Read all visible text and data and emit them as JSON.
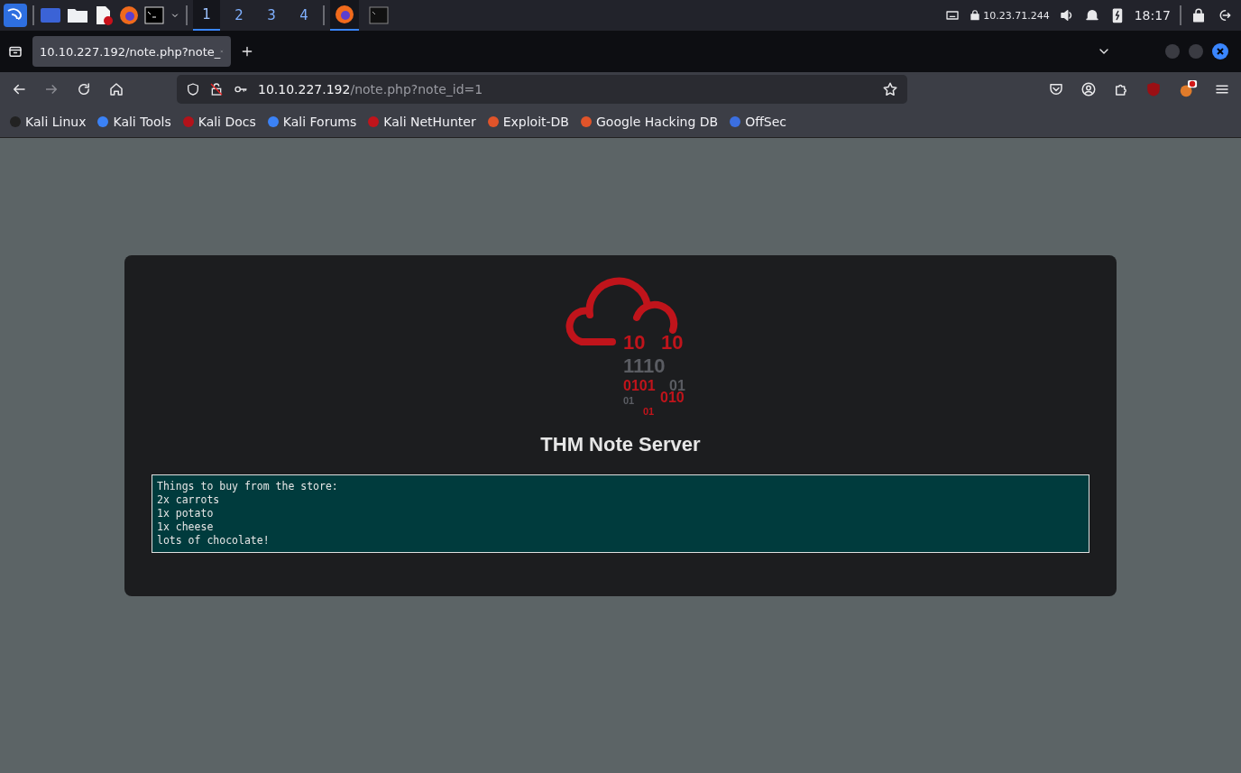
{
  "taskbar": {
    "workspaces": [
      {
        "label": "1",
        "selected": true
      },
      {
        "label": "2",
        "selected": false
      },
      {
        "label": "3",
        "selected": false
      },
      {
        "label": "4",
        "selected": false
      }
    ],
    "ip": "10.23.71.244",
    "clock": "18:17"
  },
  "browser": {
    "tab": {
      "title": "10.10.227.192/note.php?note_"
    },
    "url": {
      "host": "10.10.227.192",
      "path": "/note.php?note_id=1"
    },
    "bookmarks": [
      "Kali Linux",
      "Kali Tools",
      "Kali Docs",
      "Kali Forums",
      "Kali NetHunter",
      "Exploit-DB",
      "Google Hacking DB",
      "OffSec"
    ]
  },
  "page": {
    "logo_digits": [
      {
        "text": "10",
        "color": "#c0141b"
      },
      {
        "text": "10",
        "color": "#c0141b"
      },
      {
        "text": "1110",
        "color": "#5a5c62"
      },
      {
        "text": "0101",
        "color": "#c0141b"
      },
      {
        "text": "01",
        "color": "#5a5c62"
      },
      {
        "text": "01",
        "color": "#5a5c62"
      },
      {
        "text": "010",
        "color": "#c0141b"
      },
      {
        "text": "01",
        "color": "#c0141b"
      }
    ],
    "title": "THM Note Server",
    "note": {
      "value": "Things to buy from the store:\n2x carrots\n1x potato\n1x cheese\nlots of chocolate!"
    }
  }
}
